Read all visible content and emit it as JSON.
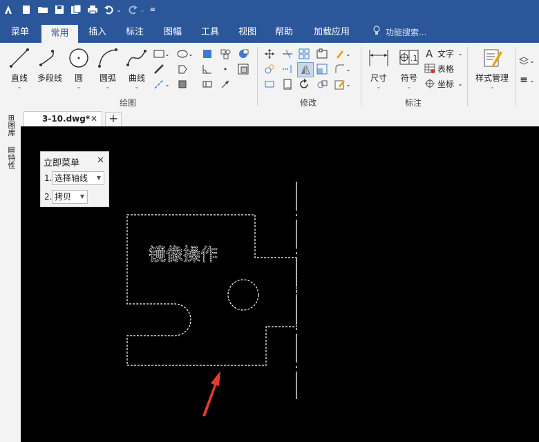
{
  "tabs": [
    "菜单",
    "常用",
    "插入",
    "标注",
    "图幅",
    "工具",
    "视图",
    "帮助",
    "加载应用"
  ],
  "search_placeholder": "功能搜索...",
  "draw_tools": [
    "直线",
    "多段线",
    "圆",
    "圆弧",
    "曲线"
  ],
  "group_labels": {
    "draw": "绘图",
    "modify": "修改",
    "annotate": "标注"
  },
  "annotate": {
    "dimension": "尺寸",
    "symbol": "符号",
    "text": "文字",
    "table": "表格",
    "coordinate": "坐标",
    "symbol_icon_text": ".1"
  },
  "style_manager": "样式管理",
  "left_panels": [
    "图库",
    "特性"
  ],
  "document_tab": "3-10.dwg*",
  "immediate_menu": {
    "title": "立即菜单",
    "row1_num": "1.",
    "row1_value": "选择轴线",
    "row2_num": "2.",
    "row2_value": "拷贝"
  },
  "drawing": {
    "label": "镜像操作"
  },
  "colors": {
    "accent": "#2b579a",
    "ribbon": "#f3f3f3",
    "canvas": "#000000",
    "arrow": "#e83a2f"
  },
  "icons": {
    "app": "app-logo-icon",
    "new": "new-file-icon",
    "open": "open-folder-icon",
    "save": "save-icon",
    "print": "print-icon",
    "undo": "undo-icon",
    "redo": "redo-icon"
  }
}
